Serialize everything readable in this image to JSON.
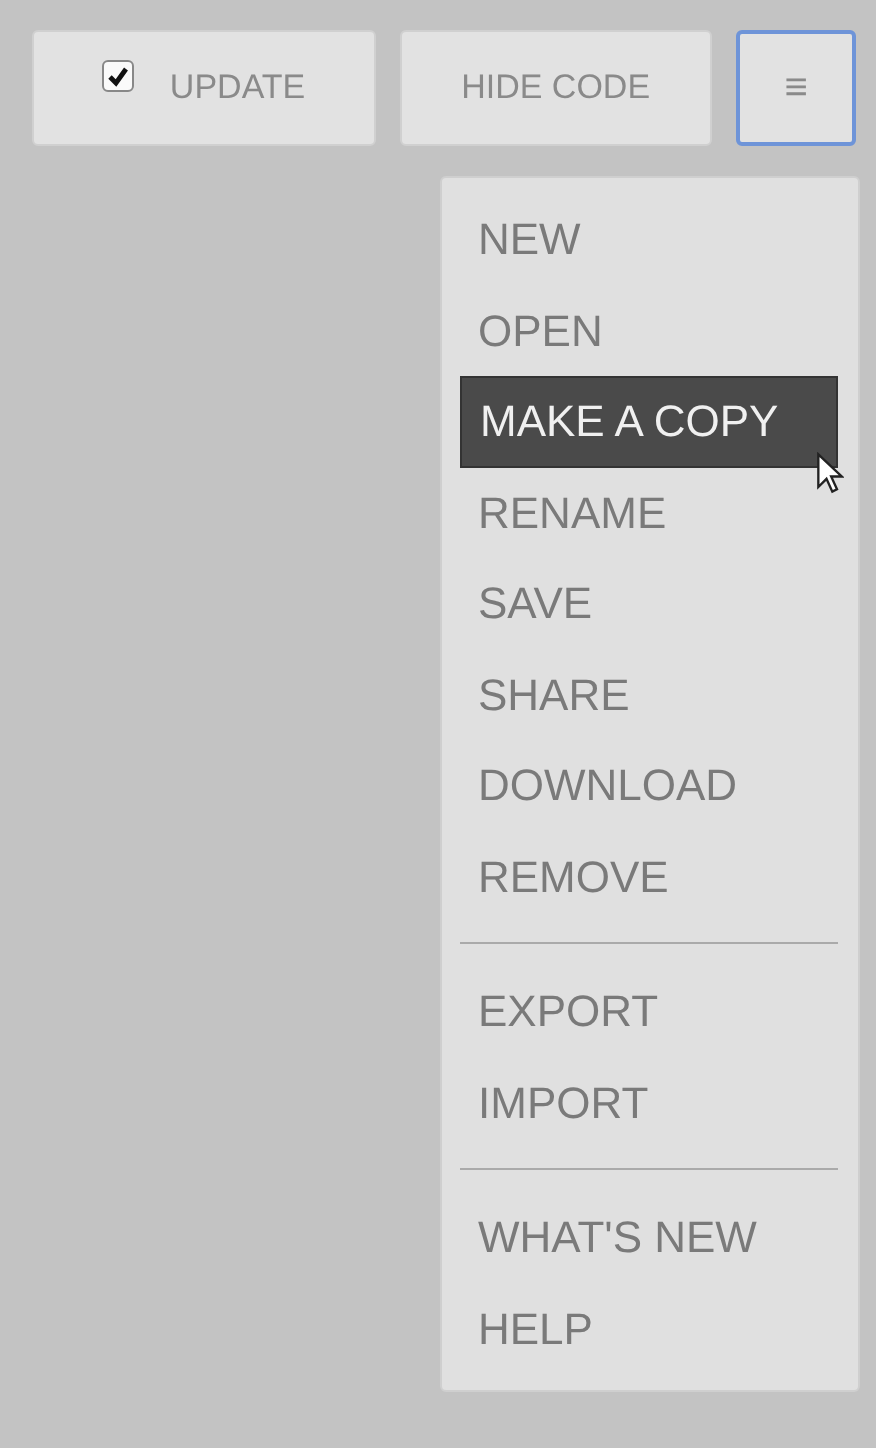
{
  "toolbar": {
    "update": {
      "label": "UPDATE",
      "checked": true
    },
    "hide_code": {
      "label": "HIDE CODE"
    },
    "menu_button": {
      "label": "≡",
      "focused": true
    }
  },
  "menu": {
    "sections": [
      {
        "items": [
          {
            "label": "NEW",
            "selected": false
          },
          {
            "label": "OPEN",
            "selected": false
          },
          {
            "label": "MAKE A COPY",
            "selected": true
          },
          {
            "label": "RENAME",
            "selected": false
          },
          {
            "label": "SAVE",
            "selected": false
          },
          {
            "label": "SHARE",
            "selected": false
          },
          {
            "label": "DOWNLOAD",
            "selected": false
          },
          {
            "label": "REMOVE",
            "selected": false
          }
        ]
      },
      {
        "items": [
          {
            "label": "EXPORT",
            "selected": false
          },
          {
            "label": "IMPORT",
            "selected": false
          }
        ]
      },
      {
        "items": [
          {
            "label": "WHAT'S NEW",
            "selected": false
          },
          {
            "label": "HELP",
            "selected": false
          }
        ]
      }
    ]
  }
}
